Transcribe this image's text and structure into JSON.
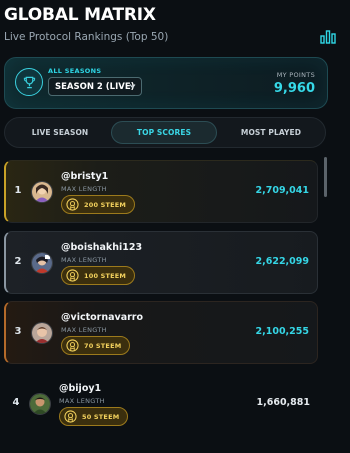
{
  "header": {
    "title": "GLOBAL MATRIX",
    "subtitle": "Live Protocol Rankings (Top 50)",
    "stats_icon": "bar-chart-icon"
  },
  "season": {
    "label": "ALL SEASONS",
    "selected": "SEASON 2 (LIVE)",
    "icon": "trophy-icon",
    "points_label": "MY POINTS",
    "points_value": "9,960"
  },
  "tabs": [
    {
      "label": "LIVE SEASON",
      "active": false
    },
    {
      "label": "TOP SCORES",
      "active": true
    },
    {
      "label": "MOST PLAYED",
      "active": false
    }
  ],
  "leaderboard": [
    {
      "rank": "1",
      "username": "@bristy1",
      "metric_label": "MAX LENGTH",
      "reward": "200 STEEM",
      "score": "2,709,041"
    },
    {
      "rank": "2",
      "username": "@boishakhi123",
      "metric_label": "MAX LENGTH",
      "reward": "100 STEEM",
      "score": "2,622,099"
    },
    {
      "rank": "3",
      "username": "@victornavarro",
      "metric_label": "MAX LENGTH",
      "reward": "70 STEEM",
      "score": "2,100,255"
    },
    {
      "rank": "4",
      "username": "@bijoy1",
      "metric_label": "MAX LENGTH",
      "reward": "50 STEEM",
      "score": "1,660,881"
    }
  ],
  "colors": {
    "accent": "#36d9e8",
    "gold": "#c9a227",
    "silver": "#8a96a1",
    "bronze": "#b46a2a",
    "background": "#0b0f13"
  }
}
